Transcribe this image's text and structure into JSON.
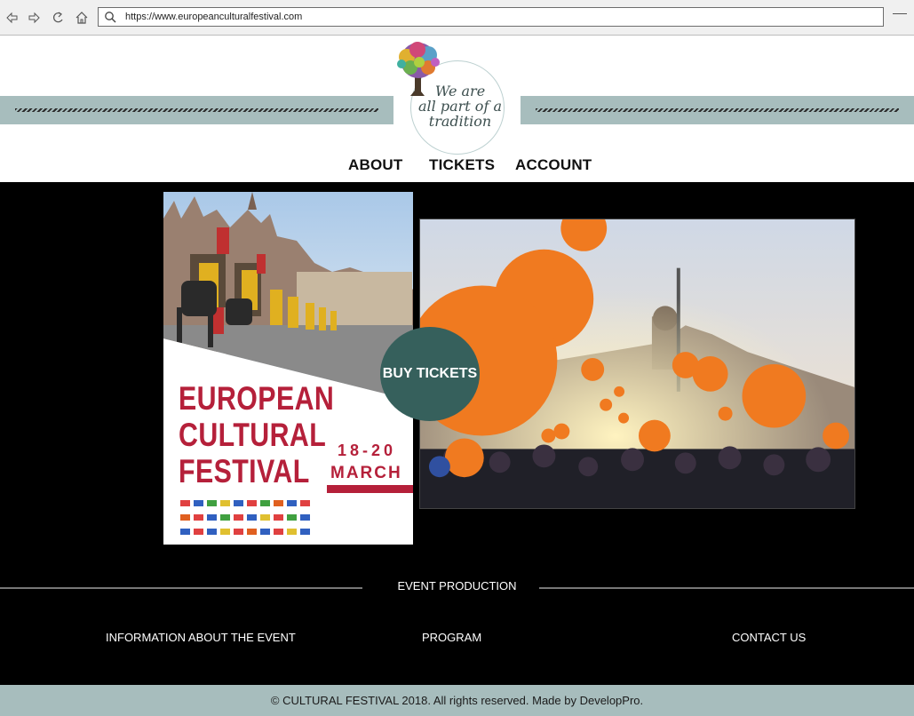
{
  "browser": {
    "url": "https://www.europeanculturalfestival.com",
    "icons": [
      "back-icon",
      "forward-icon",
      "refresh-icon",
      "home-icon",
      "search-icon",
      "menu-icon"
    ]
  },
  "header": {
    "logo_lines": [
      "We are",
      "all part of a",
      "tradition"
    ],
    "nav": [
      "ABOUT",
      "TICKETS",
      "ACCOUNT"
    ],
    "band_color": "#a7bdbd"
  },
  "hero": {
    "poster": {
      "title_lines": [
        "EUROPEAN",
        "CULTURAL",
        "FESTIVAL"
      ],
      "dates": "18-20",
      "month": "MARCH",
      "accent_color": "#b5203a"
    },
    "buy_button": "BUY TICKETS",
    "buy_button_color": "#36605c"
  },
  "links": {
    "section_title": "EVENT PRODUCTION",
    "items": [
      "INFORMATION ABOUT THE EVENT",
      "PROGRAM",
      "CONTACT US"
    ]
  },
  "footer": {
    "text": "© CULTURAL FESTIVAL 2018. All rights reserved. Made by DevelopPro."
  }
}
